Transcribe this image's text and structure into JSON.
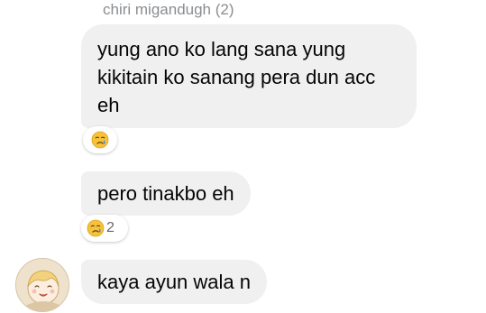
{
  "thread": {
    "sender_name": "chiri migandugh (2)",
    "messages": [
      {
        "lines": [
          "yung ano ko lang sana yung",
          "kikitain ko sanang pera dun acc",
          "eh"
        ],
        "reaction": {
          "icon": "crying-face-emoji",
          "count": ""
        }
      },
      {
        "text": "pero tinakbo eh",
        "reaction": {
          "icon": "crying-face-emoji",
          "count": "2"
        }
      },
      {
        "text": "kaya ayun wala n",
        "reaction": null
      }
    ]
  },
  "avatar": {
    "icon": "cartoon-avatar"
  },
  "colors": {
    "bubble_bg": "#f0f0f0",
    "text": "#050505",
    "meta_text": "#8a8d91",
    "reaction_bg": "#ffffff"
  }
}
